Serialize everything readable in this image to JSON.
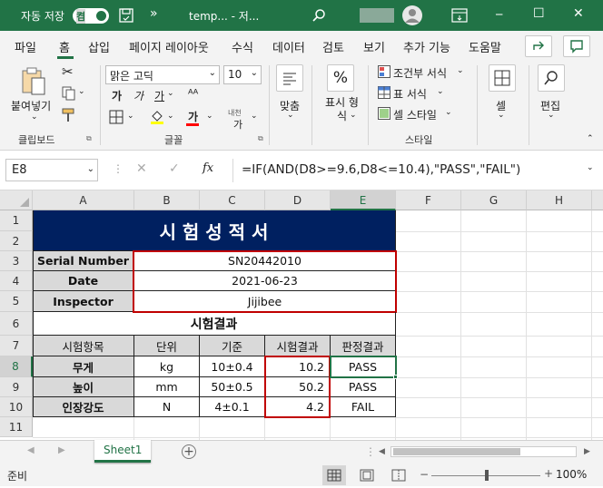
{
  "titlebar": {
    "autosave_label": "자동 저장",
    "autosave_state": "켬",
    "overflow": "»",
    "filename": "temp... - 저...",
    "minimize": "─",
    "maximize": "☐",
    "close": "✕"
  },
  "menu": {
    "items": [
      "파일",
      "홈",
      "삽입",
      "페이지 레이아웃",
      "수식",
      "데이터",
      "검토",
      "보기",
      "추가 기능",
      "도움말"
    ],
    "active": "홈"
  },
  "ribbon": {
    "paste": "붙여넣기",
    "clipboard_group": "클립보드",
    "font_name": "맑은 고딕",
    "font_size": "10",
    "bold": "가",
    "italic": "가",
    "underline": "가",
    "font_color_btn": "가",
    "phonetic": "내천",
    "font_group": "글꼴",
    "align": "맞춤",
    "number_format": "표시 형식",
    "percent": "%",
    "conditional": "조건부 서식",
    "table_format": "표 서식",
    "cell_style": "셀 스타일",
    "style_group": "스타일",
    "cells": "셀",
    "editing": "편집"
  },
  "formula_bar": {
    "name_box": "E8",
    "fx": "fx",
    "formula": "=IF(AND(D8>=9.6,D8<=10.4),\"PASS\",\"FAIL\")"
  },
  "columns": [
    "A",
    "B",
    "C",
    "D",
    "E",
    "F",
    "G",
    "H"
  ],
  "rows": [
    "1",
    "2",
    "3",
    "4",
    "5",
    "6",
    "7",
    "8",
    "9",
    "10",
    "11"
  ],
  "sheet": {
    "title": "시 험 성 적 서",
    "serial_label": "Serial Number",
    "serial_value": "SN20442010",
    "date_label": "Date",
    "date_value": "2021-06-23",
    "inspector_label": "Inspector",
    "inspector_value": "Jijibee",
    "results_title": "시험결과",
    "headers": [
      "시험항목",
      "단위",
      "기준",
      "시험결과",
      "판정결과"
    ],
    "data": [
      [
        "무게",
        "kg",
        "10±0.4",
        "10.2",
        "PASS"
      ],
      [
        "높이",
        "mm",
        "50±0.5",
        "50.2",
        "PASS"
      ],
      [
        "인장강도",
        "N",
        "4±0.1",
        "4.2",
        "FAIL"
      ]
    ]
  },
  "sheet_tabs": {
    "active": "Sheet1",
    "add": "+"
  },
  "status": {
    "mode": "준비",
    "zoom": "100%"
  },
  "colors": {
    "excel_green": "#217346",
    "title_navy": "#002060",
    "label_gray": "#d9d9d9",
    "highlight_red": "#c00000"
  }
}
